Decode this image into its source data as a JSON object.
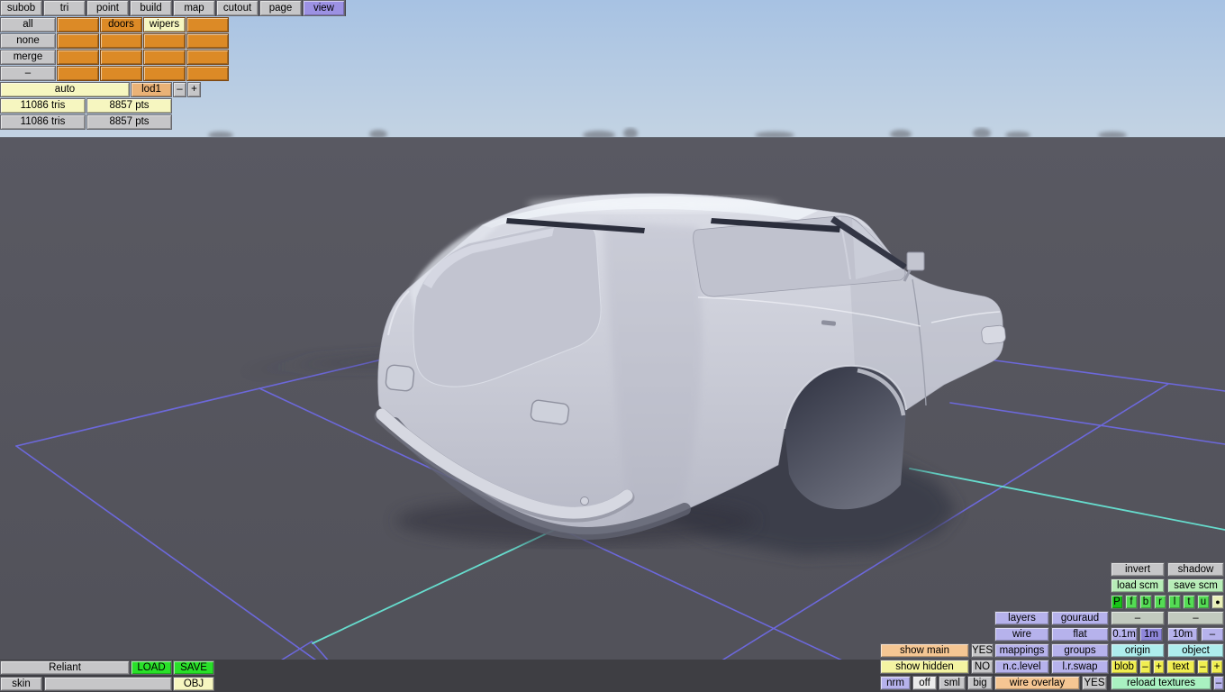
{
  "menu": {
    "tabs": [
      "subob",
      "tri",
      "point",
      "build",
      "map",
      "cutout",
      "page",
      "view"
    ],
    "active_tab": "view"
  },
  "subobjects": {
    "select_buttons": [
      "all",
      "none",
      "merge",
      "–"
    ],
    "grid": [
      [
        "",
        "doors",
        "wipers",
        ""
      ],
      [
        "",
        "",
        "",
        ""
      ],
      [
        "",
        "",
        "",
        ""
      ],
      [
        "",
        "",
        "",
        ""
      ]
    ],
    "lod": {
      "auto_label": "auto",
      "current": "lod1",
      "decrease": "–",
      "increase": "+"
    },
    "stats": {
      "selected_tris": "11086 tris",
      "selected_pts": "8857 pts",
      "total_tris": "11086 tris",
      "total_pts": "8857 pts"
    }
  },
  "file": {
    "model_name": "Reliant",
    "load_label": "LOAD",
    "save_label": "SAVE",
    "skin_label": "skin",
    "skin_value": "",
    "obj_label": "OBJ"
  },
  "view_panel": {
    "invert_label": "invert",
    "shadow_label": "shadow",
    "load_scm_label": "load scm",
    "save_scm_label": "save scm",
    "part_toggles": [
      "P",
      "f",
      "b",
      "r",
      "l",
      "t",
      "u",
      "●"
    ],
    "layers_label": "layers",
    "shading_mode": "gouraud",
    "minus_a": "–",
    "minus_b": "–",
    "wire_label": "wire",
    "flat_label": "flat",
    "grid_scale_options": [
      "0.1m",
      "1m",
      "10m"
    ],
    "grid_scale_selected": "1m",
    "grid_scale_minus": "–",
    "show_main_label": "show main",
    "show_main_value": "YES",
    "mappings_label": "mappings",
    "groups_label": "groups",
    "origin_label": "origin",
    "object_label": "object",
    "show_hidden_label": "show hidden",
    "show_hidden_value": "NO",
    "nc_level_label": "n.c.level",
    "lr_swap_label": "l.r.swap",
    "blob_label": "blob",
    "blob_minus": "–",
    "blob_plus": "+",
    "text_label": "text",
    "text_minus": "–",
    "text_plus": "+",
    "normals_label": "nrm",
    "normals_options": [
      "off",
      "sml",
      "big"
    ],
    "normals_selected": "off",
    "wire_overlay_label": "wire overlay",
    "wire_overlay_value": "YES",
    "reload_textures_label": "reload textures",
    "reload_minus": "–"
  },
  "colors": {
    "accent_purple": "#9c91e3",
    "panel_orange": "#dc8a26",
    "lavender": "#b6b2ec",
    "green_bright": "#29e029",
    "green_pale": "#b7edb7",
    "yellow": "#f0ee50",
    "cream": "#f6f6c0",
    "peach": "#f5c693",
    "cyan_pale": "#aeeded",
    "grid_purple": "#6f6ae6",
    "grid_cyan": "#68e4d4",
    "sky": "#a7c2e3",
    "ground": "#56565e"
  }
}
